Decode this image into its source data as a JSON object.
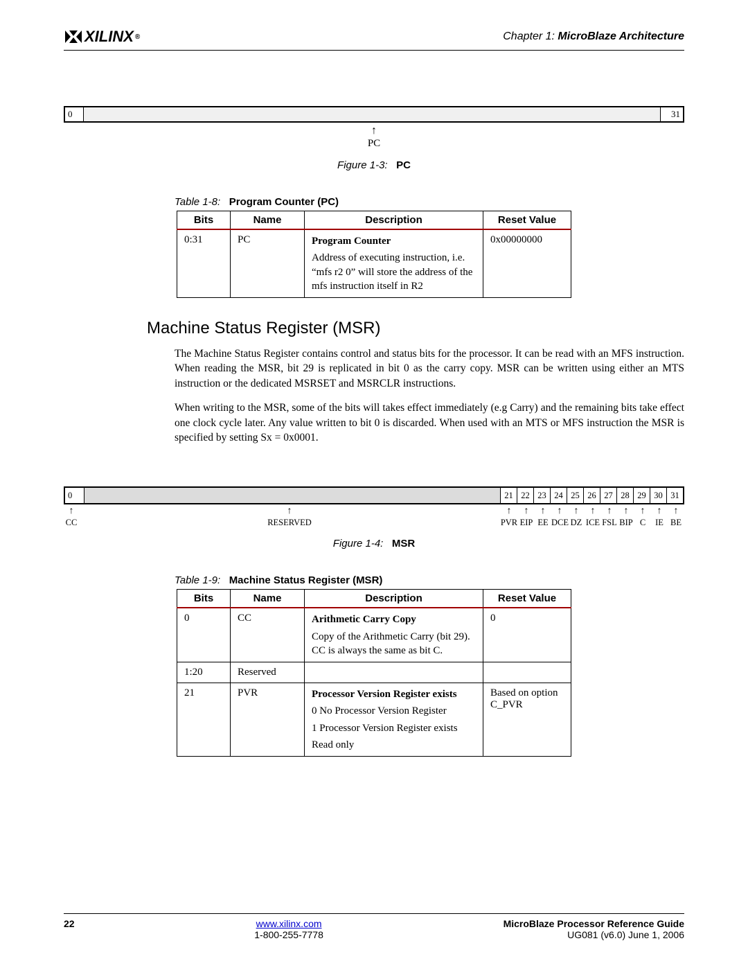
{
  "header": {
    "logo_text": "XILINX",
    "chapter_label": "Chapter 1:",
    "chapter_name": "MicroBlaze Architecture"
  },
  "fig_pc": {
    "bit_low": "0",
    "bit_high": "31",
    "arrow": "↑",
    "label": "PC",
    "caption_prefix": "Figure 1-3:",
    "caption_name": "PC"
  },
  "table_pc": {
    "caption_prefix": "Table 1-8:",
    "caption_name": "Program Counter (PC)",
    "headers": {
      "bits": "Bits",
      "name": "Name",
      "desc": "Description",
      "reset": "Reset Value"
    },
    "rows": [
      {
        "bits": "0:31",
        "name": "PC",
        "desc_bold": "Program Counter",
        "desc_rest": "Address of executing instruction, i.e. “mfs r2 0” will store the address of the mfs instruction itself in R2",
        "reset": "0x00000000"
      }
    ]
  },
  "section_msr": {
    "title": "Machine Status Register (MSR)",
    "para1": "The Machine Status Register contains control and status bits for the processor. It can be read with an MFS instruction. When reading the MSR, bit 29 is replicated in bit 0 as the carry copy. MSR can be written using either an MTS instruction or the dedicated MSRSET and MSRCLR instructions.",
    "para2": "When writing to the MSR, some of the bits will takes effect immediately (e.g Carry) and the remaining bits take effect one clock cycle later. Any value written to bit 0 is discarded. When used with an MTS or MFS instruction the MSR is specified by setting Sx = 0x0001."
  },
  "fig_msr": {
    "bit0": "0",
    "bits": [
      "21",
      "22",
      "23",
      "24",
      "25",
      "26",
      "27",
      "28",
      "29",
      "30",
      "31"
    ],
    "arrow": "↑",
    "label_cc": "CC",
    "label_reserved": "RESERVED",
    "labels": [
      "PVR",
      "EIP",
      "EE",
      "DCE",
      "DZ",
      "ICE",
      "FSL",
      "BIP",
      "C",
      "IE",
      "BE"
    ],
    "caption_prefix": "Figure 1-4:",
    "caption_name": "MSR"
  },
  "table_msr": {
    "caption_prefix": "Table 1-9:",
    "caption_name": "Machine Status Register (MSR)",
    "headers": {
      "bits": "Bits",
      "name": "Name",
      "desc": "Description",
      "reset": "Reset Value"
    },
    "rows": [
      {
        "bits": "0",
        "name": "CC",
        "desc_bold": "Arithmetic Carry Copy",
        "desc_lines": [
          "Copy of the Arithmetic Carry (bit 29). CC is always the same as bit C."
        ],
        "reset": "0"
      },
      {
        "bits": "1:20",
        "name": "Reserved",
        "desc_bold": "",
        "desc_lines": [],
        "reset": ""
      },
      {
        "bits": "21",
        "name": "PVR",
        "desc_bold": "Processor Version Register exists",
        "desc_lines": [
          "0 No Processor Version Register",
          "1 Processor Version Register exists",
          "Read only"
        ],
        "reset": "Based on option C_PVR"
      }
    ]
  },
  "footer": {
    "page": "22",
    "url": "www.xilinx.com",
    "phone": "1-800-255-7778",
    "title": "MicroBlaze Processor Reference Guide",
    "docid": "UG081 (v6.0) June 1, 2006"
  }
}
